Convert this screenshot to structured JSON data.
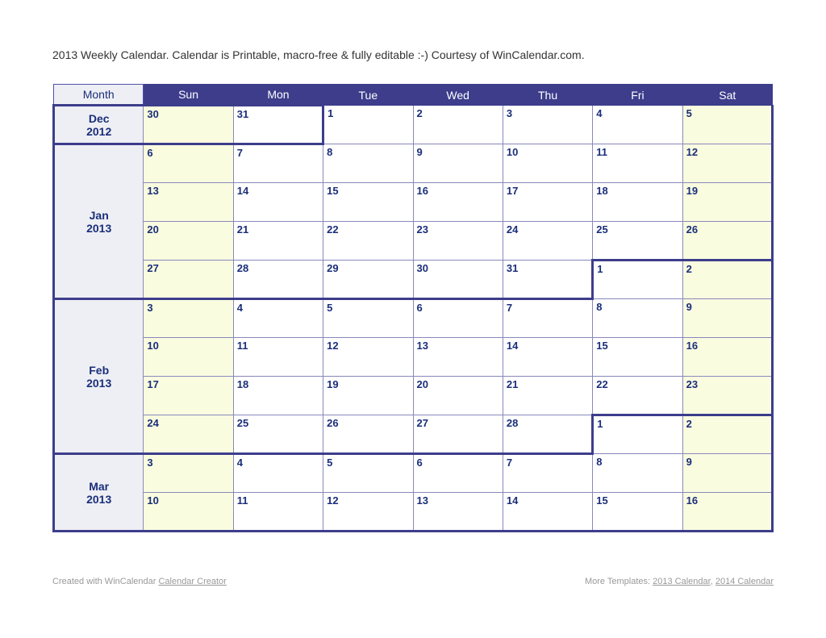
{
  "title": "2013 Weekly Calendar.  Calendar is Printable, macro-free & fully editable :-)  Courtesy of WinCalendar.com.",
  "headers": [
    "Month",
    "Sun",
    "Mon",
    "Tue",
    "Wed",
    "Thu",
    "Fri",
    "Sat"
  ],
  "months": [
    {
      "name": "Dec",
      "year": "2012",
      "rows": 1
    },
    {
      "name": "Jan",
      "year": "2013",
      "rows": 4
    },
    {
      "name": "Feb",
      "year": "2013",
      "rows": 4
    },
    {
      "name": "Mar",
      "year": "2013",
      "rows": 2
    }
  ],
  "weeks": [
    [
      "30",
      "31",
      "1",
      "2",
      "3",
      "4",
      "5"
    ],
    [
      "6",
      "7",
      "8",
      "9",
      "10",
      "11",
      "12"
    ],
    [
      "13",
      "14",
      "15",
      "16",
      "17",
      "18",
      "19"
    ],
    [
      "20",
      "21",
      "22",
      "23",
      "24",
      "25",
      "26"
    ],
    [
      "27",
      "28",
      "29",
      "30",
      "31",
      "1",
      "2"
    ],
    [
      "3",
      "4",
      "5",
      "6",
      "7",
      "8",
      "9"
    ],
    [
      "10",
      "11",
      "12",
      "13",
      "14",
      "15",
      "16"
    ],
    [
      "17",
      "18",
      "19",
      "20",
      "21",
      "22",
      "23"
    ],
    [
      "24",
      "25",
      "26",
      "27",
      "28",
      "1",
      "2"
    ],
    [
      "3",
      "4",
      "5",
      "6",
      "7",
      "8",
      "9"
    ],
    [
      "10",
      "11",
      "12",
      "13",
      "14",
      "15",
      "16"
    ]
  ],
  "footer": {
    "left_prefix": "Created with WinCalendar ",
    "left_link": "Calendar Creator",
    "right_prefix": "More Templates: ",
    "right_link1": "2013 Calendar",
    "right_sep": ", ",
    "right_link2": "2014 Calendar"
  }
}
